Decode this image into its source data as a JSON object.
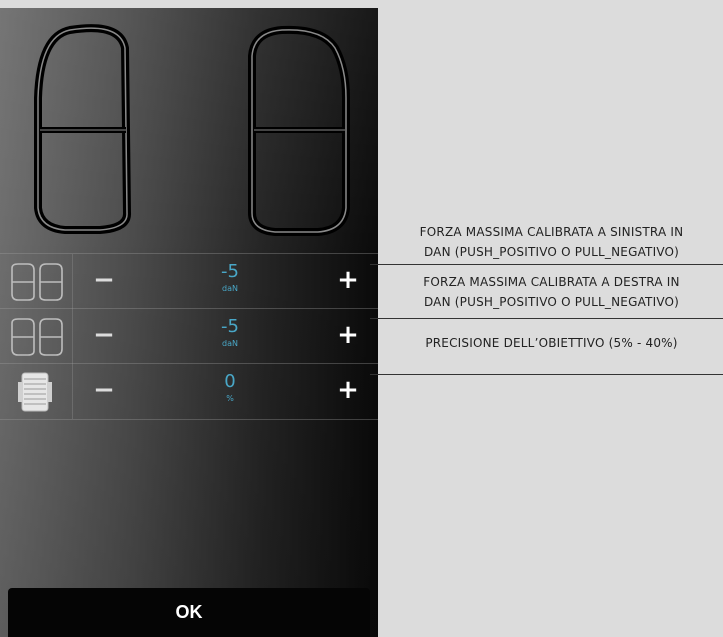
{
  "rows": [
    {
      "value": "-5",
      "unit": "daN",
      "minus": "−",
      "plus": "+"
    },
    {
      "value": "-5",
      "unit": "daN",
      "minus": "−",
      "plus": "+"
    },
    {
      "value": "0",
      "unit": "%",
      "minus": "−",
      "plus": "+"
    }
  ],
  "ok_label": "OK",
  "annotations": [
    {
      "line1": "FORZA MASSIMA CALIBRATA A SINISTRA IN",
      "line2": "DAN (PUSH_POSITIVO  O PULL_NEGATIVO)"
    },
    {
      "line1": "FORZA MASSIMA CALIBRATA A DESTRA IN",
      "line2": "DAN (PUSH_POSITIVO  O PULL_NEGATIVO)"
    },
    {
      "line1": "PRECISIONE  DELL’OBIETTIVO (5% - 40%)"
    }
  ],
  "colors": {
    "value": "#49a7c7",
    "panel_dark": "#0a0a0a",
    "page_bg": "#dcdcdc"
  },
  "icons": {
    "row1": "dual-handle-icon",
    "row2": "dual-handle-icon",
    "row3": "precision-target-icon"
  }
}
